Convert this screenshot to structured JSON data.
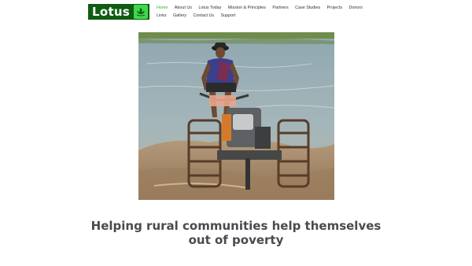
{
  "brand": {
    "name": "Lotus",
    "logo_icon": "lotus-flower-icon",
    "logo_bg": "#0f5c12",
    "logo_accent": "#3fd94a"
  },
  "nav": {
    "active_color": "#35b23c",
    "items": [
      {
        "label": "Home",
        "active": true
      },
      {
        "label": "About Us"
      },
      {
        "label": "Lotus Today"
      },
      {
        "label": "Mission & Principles"
      },
      {
        "label": "Partners"
      },
      {
        "label": "Case Studies"
      },
      {
        "label": "Projects"
      },
      {
        "label": "Donors"
      },
      {
        "label": "Links"
      },
      {
        "label": "Gallery"
      },
      {
        "label": "Contact Us"
      },
      {
        "label": "Support"
      }
    ]
  },
  "hero": {
    "image": "farmer-on-hand-tractor-in-rice-paddy"
  },
  "headline": {
    "text": "Helping rural communities help themselves out of poverty"
  }
}
